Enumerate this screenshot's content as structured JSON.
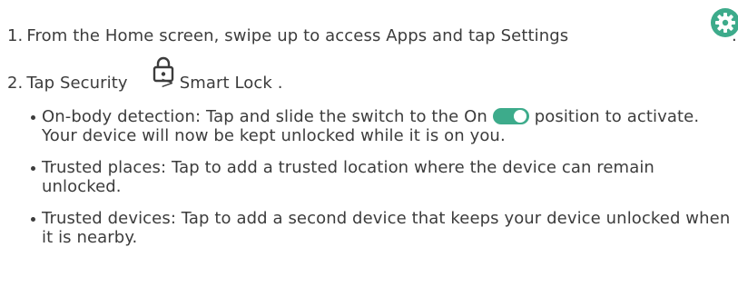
{
  "step1": {
    "number": "1.",
    "text": "From the Home screen, swipe up to access Apps and tap Settings",
    "suffix": "."
  },
  "step2": {
    "number": "2.",
    "text_before": "Tap Security",
    "text_after": "> Smart Lock ."
  },
  "bullets": [
    {
      "text_before": "On-body detection: Tap and slide the switch to the On",
      "text_after": "position to activate. Your device will now be kept unlocked while it is on you."
    },
    {
      "text": "Trusted places: Tap to add a trusted location where the device can remain unlocked."
    },
    {
      "text": "Trusted devices: Tap to add a second device that keeps your device unlocked when it is nearby."
    }
  ],
  "icons": {
    "settings": "gear-icon",
    "security": "lock-icon",
    "switch": "toggle-on-icon"
  },
  "colors": {
    "accent": "#3dab8b",
    "text": "#3c3c3c"
  }
}
